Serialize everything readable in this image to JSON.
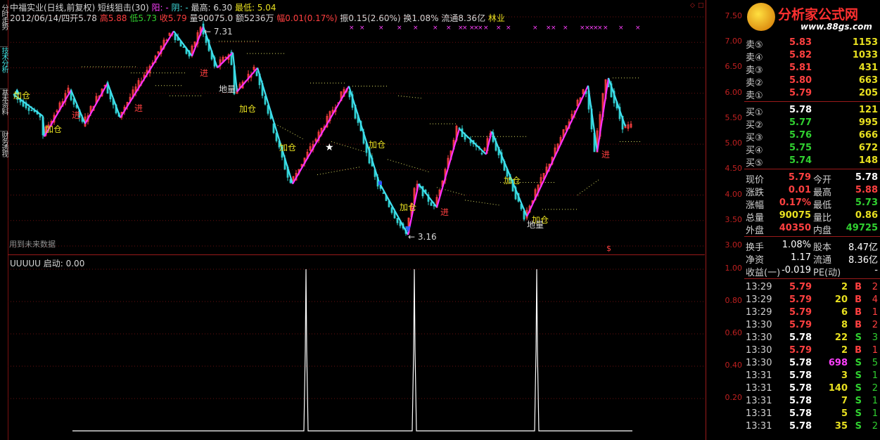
{
  "side_tabs": [
    "分时走势",
    "技术分析",
    "基本资料",
    "财务透视"
  ],
  "header": {
    "name_line": "中福实业(日线,前复权)",
    "indicator": "短线狙击(30)",
    "yang_label": "阳: -",
    "yin_label": "阴: -",
    "high_label": "最高: 6.30",
    "low_label": "最低: 5.04",
    "date": "2012/06/14/四",
    "open": "开5.78",
    "high": "高5.88",
    "low": "低5.73",
    "close": "收5.79",
    "vol": "量90075.0",
    "amount": "额5236万",
    "change": "幅0.01(0.17%)",
    "amplitude": "振0.15(2.60%)",
    "turnover": "换1.08%",
    "float": "流通8.36亿",
    "industry": "林业"
  },
  "main_chart": {
    "y_ticks": [
      "7.50",
      "7.00",
      "6.50",
      "6.00",
      "5.50",
      "5.00",
      "4.50",
      "4.00",
      "3.50",
      "3.00"
    ],
    "max_label": "7.31",
    "min_label": "3.16",
    "future_note": "用到未来数据",
    "annotations": {
      "jiacang": "加仓",
      "jin": "进",
      "diliang": "地量"
    },
    "dollar": "$"
  },
  "sub_chart": {
    "title": "UUUUU",
    "start_label": "启动: 0.00",
    "y_ticks": [
      "1.00",
      "0.80",
      "0.60",
      "0.40",
      "0.20"
    ]
  },
  "logo": {
    "brand": "分析家公式网",
    "url": "www.88gs.com"
  },
  "sell_book": [
    {
      "label": "卖⑤",
      "price": "5.83",
      "vol": "1153"
    },
    {
      "label": "卖④",
      "price": "5.82",
      "vol": "1033"
    },
    {
      "label": "卖③",
      "price": "5.81",
      "vol": "431"
    },
    {
      "label": "卖②",
      "price": "5.80",
      "vol": "663"
    },
    {
      "label": "卖①",
      "price": "5.79",
      "vol": "205"
    }
  ],
  "buy_book": [
    {
      "label": "买①",
      "price": "5.78",
      "vol": "121"
    },
    {
      "label": "买②",
      "price": "5.77",
      "vol": "995"
    },
    {
      "label": "买③",
      "price": "5.76",
      "vol": "666"
    },
    {
      "label": "买④",
      "price": "5.75",
      "vol": "672"
    },
    {
      "label": "买⑤",
      "price": "5.74",
      "vol": "148"
    }
  ],
  "stats": [
    {
      "k1": "现价",
      "v1": "5.79",
      "k2": "今开",
      "v2": "5.78"
    },
    {
      "k1": "涨跌",
      "v1": "0.01",
      "k2": "最高",
      "v2": "5.88"
    },
    {
      "k1": "涨幅",
      "v1": "0.17%",
      "k2": "最低",
      "v2": "5.73"
    },
    {
      "k1": "总量",
      "v1": "90075",
      "k2": "量比",
      "v2": "0.86"
    },
    {
      "k1": "外盘",
      "v1": "40350",
      "k2": "内盘",
      "v2": "49725"
    }
  ],
  "stats2": [
    {
      "k1": "换手",
      "v1": "1.08%",
      "k2": "股本",
      "v2": "8.47亿"
    },
    {
      "k1": "净资",
      "v1": "1.17",
      "k2": "流通",
      "v2": "8.36亿"
    },
    {
      "k1": "收益(一)",
      "v1": "-0.019",
      "k2": "PE(动)",
      "v2": "-"
    }
  ],
  "ticks": [
    {
      "t": "13:29",
      "p": "5.79",
      "v": "2",
      "s": "B",
      "n": "2"
    },
    {
      "t": "13:29",
      "p": "5.79",
      "v": "20",
      "s": "B",
      "n": "4"
    },
    {
      "t": "13:29",
      "p": "5.79",
      "v": "6",
      "s": "B",
      "n": "1"
    },
    {
      "t": "13:30",
      "p": "5.79",
      "v": "8",
      "s": "B",
      "n": "2"
    },
    {
      "t": "13:30",
      "p": "5.78",
      "v": "22",
      "s": "S",
      "n": "3"
    },
    {
      "t": "13:30",
      "p": "5.79",
      "v": "2",
      "s": "B",
      "n": "1"
    },
    {
      "t": "13:30",
      "p": "5.78",
      "v": "698",
      "s": "S",
      "n": "5"
    },
    {
      "t": "13:31",
      "p": "5.78",
      "v": "3",
      "s": "S",
      "n": "1"
    },
    {
      "t": "13:31",
      "p": "5.78",
      "v": "140",
      "s": "S",
      "n": "2"
    },
    {
      "t": "13:31",
      "p": "5.78",
      "v": "7",
      "s": "S",
      "n": "1"
    },
    {
      "t": "13:31",
      "p": "5.78",
      "v": "5",
      "s": "S",
      "n": "1"
    },
    {
      "t": "13:31",
      "p": "5.78",
      "v": "35",
      "s": "S",
      "n": "2"
    }
  ],
  "colors": {
    "up": "#ff4040",
    "down": "#30d030",
    "zigzag_up": "#ff30ff",
    "zigzag_down": "#40e0f0",
    "grid": "#9a1a1a"
  }
}
